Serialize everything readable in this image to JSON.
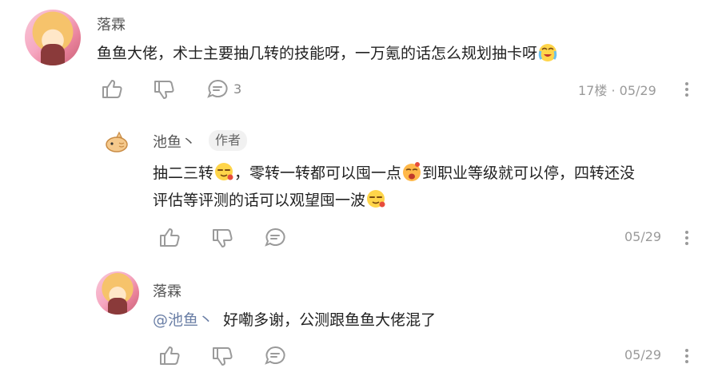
{
  "comments": [
    {
      "author": "落霖",
      "text": "鱼鱼大佬，术士主要抽几转的技能呀，一万氪的话怎么规划抽卡呀",
      "emoji": "crying-laughing-face-emoji",
      "reply_count": "3",
      "floor": "17楼",
      "separator": "·",
      "date": "05/29"
    },
    {
      "author": "池鱼丶",
      "badge": "作者",
      "text_parts": [
        "抽二三转",
        "，零转一转都可以囤一点",
        "到职业等级就可以停，四转还没",
        "评估等评测的话可以观望囤一波"
      ],
      "date": "05/29"
    },
    {
      "author": "落霖",
      "mention": "@池鱼丶",
      "text": "好嘞多谢，公测跟鱼鱼大佬混了",
      "date": "05/29"
    }
  ],
  "colors": {
    "icon": "#9a9a9a",
    "text": "#222222",
    "meta": "#9a9a9a"
  }
}
